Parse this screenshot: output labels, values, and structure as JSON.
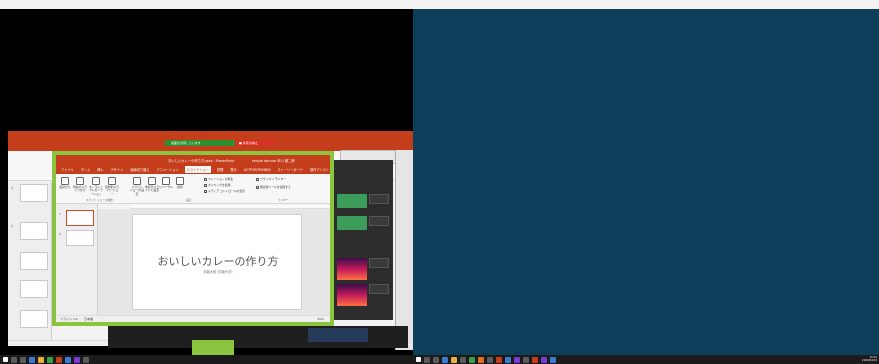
{
  "front_ppt": {
    "title": "おいしいカレーの作り方.pptx - PowerPoint",
    "user": "kenjiro tamura 市川 健二郎",
    "tabs": [
      "ファイル",
      "ホーム",
      "挿入",
      "デザイン",
      "画面切り替え",
      "アニメーション",
      "スライドショー",
      "校閲",
      "表示",
      "ACTPOP/TRENDS",
      "ストーリーボード",
      "操作アシスト"
    ],
    "active_tab_index": 6,
    "ribbon": {
      "b1": "最初から",
      "b2": "現在のスライドから",
      "b3": "オンライン プレゼンテーション",
      "b4": "目的別スライド ショー",
      "b5": "スライド ショーの設定",
      "b6": "非表示スライドに設定",
      "b7": "リハーサル",
      "b8": "録音",
      "chk1": "ナレーションの再生",
      "chk2": "タイミングを使用",
      "chk3": "メディア コントロールの表示",
      "chk4": "発表者ツールを使用する",
      "grp1": "スライド ショーの開始",
      "grp2": "設定",
      "grp3": "モニター",
      "monitor": "プライマリ モニター"
    },
    "slide_title": "おいしいカレーの作り方",
    "slide_subtitle": "情報太郎 (情報大学)",
    "status_slide": "スライド 1/2",
    "status_lang": "日本語",
    "status_zoom": "45%"
  },
  "share_bar": {
    "message": "画面を共有しています",
    "stop": "■ 共有の停止"
  },
  "taskbar": {
    "time_right": "10:01",
    "date_right": "2020/04/13"
  },
  "colors": {
    "ppt_red": "#c43e1c",
    "capture_green": "#8bc43f",
    "desktop_blue": "#0d3f5a",
    "taskbar": "#1b1b1b"
  }
}
